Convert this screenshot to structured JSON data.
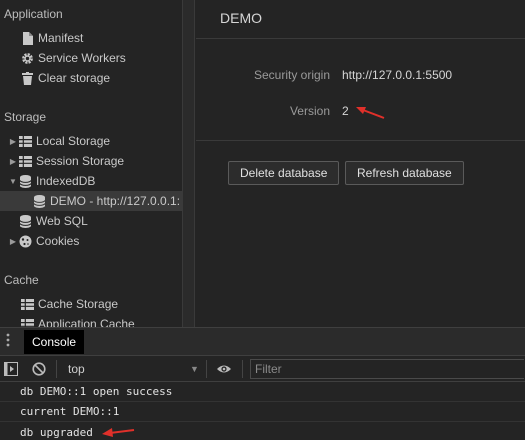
{
  "sidebar": {
    "sections": {
      "application": "Application",
      "storage": "Storage",
      "cache": "Cache"
    },
    "application_items": [
      {
        "label": "Manifest",
        "icon": "document-icon"
      },
      {
        "label": "Service Workers",
        "icon": "gear-icon"
      },
      {
        "label": "Clear storage",
        "icon": "trash-icon"
      }
    ],
    "storage_items": [
      {
        "label": "Local Storage",
        "icon": "grid-icon"
      },
      {
        "label": "Session Storage",
        "icon": "grid-icon"
      },
      {
        "label": "IndexedDB",
        "icon": "database-icon"
      },
      {
        "label": "DEMO - http://127.0.0.1:",
        "icon": "database-icon"
      },
      {
        "label": "Web SQL",
        "icon": "database-icon"
      },
      {
        "label": "Cookies",
        "icon": "cookie-icon"
      }
    ],
    "cache_items": [
      {
        "label": "Cache Storage",
        "icon": "grid-icon"
      },
      {
        "label": "Application Cache",
        "icon": "grid-icon"
      }
    ]
  },
  "main": {
    "title": "DEMO",
    "security_origin_label": "Security origin",
    "security_origin_value": "http://127.0.0.1:5500",
    "version_label": "Version",
    "version_value": "2",
    "delete_button": "Delete database",
    "refresh_button": "Refresh database"
  },
  "drawer": {
    "console_tab": "Console",
    "context": "top",
    "filter_placeholder": "Filter"
  },
  "console_lines": [
    "db DEMO::1 open success",
    "current DEMO::1",
    "db upgraded"
  ],
  "colors": {
    "annotation_arrow": "#e0302a",
    "selected_row": "#3a3a3a"
  }
}
